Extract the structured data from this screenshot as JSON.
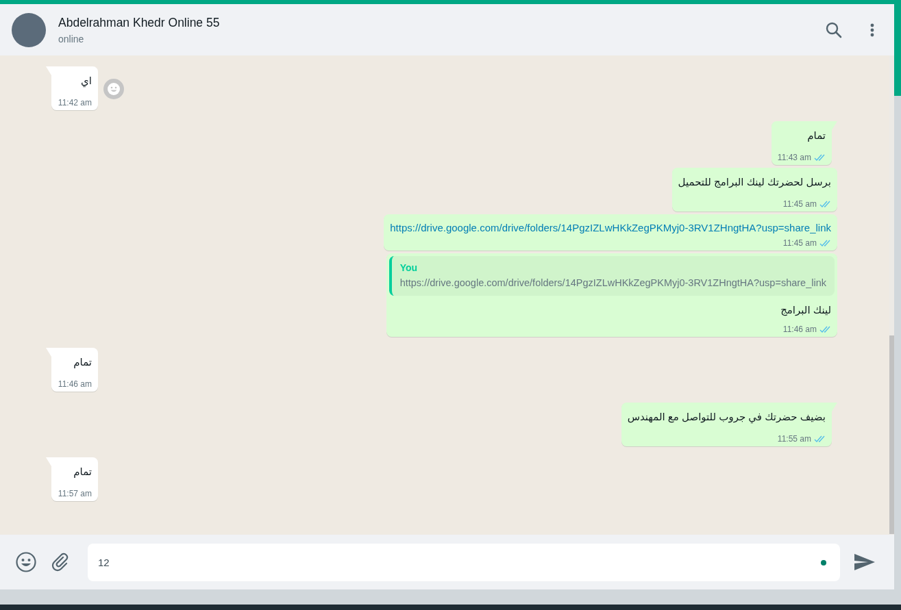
{
  "header": {
    "contact_name": "Abdelrahman Khedr Online 55",
    "status": "online"
  },
  "messages": [
    {
      "kind": "text",
      "outgoing": false,
      "tail": true,
      "hovered": true,
      "text": "اي",
      "time": "11:42 am"
    },
    {
      "kind": "text",
      "outgoing": true,
      "tail": true,
      "hovered": false,
      "text": "تمام",
      "time": "11:43 am",
      "read": true
    },
    {
      "kind": "text",
      "outgoing": true,
      "tail": false,
      "hovered": false,
      "text": "برسل لحضرتك لينك البرامج للتحميل",
      "time": "11:45 am",
      "read": true
    },
    {
      "kind": "link",
      "outgoing": true,
      "tail": false,
      "hovered": false,
      "text": "https://drive.google.com/drive/folders/14PgzIZLwHKkZegPKMyj0-3RV1ZHngtHA?usp=share_link",
      "time": "11:45 am",
      "read": true
    },
    {
      "kind": "reply",
      "outgoing": true,
      "tail": false,
      "hovered": false,
      "quote": {
        "author": "You",
        "text": "https://drive.google.com/drive/folders/14PgzIZLwHKkZegPKMyj0-3RV1ZHngtHA?usp=share_link"
      },
      "text": "لينك البرامج",
      "time": "11:46 am",
      "read": true
    },
    {
      "kind": "text",
      "outgoing": false,
      "tail": true,
      "hovered": false,
      "text": "تمام",
      "time": "11:46 am"
    },
    {
      "kind": "text",
      "outgoing": true,
      "tail": true,
      "hovered": false,
      "text": "بضيف حضرتك في جروب للتواصل مع المهندس",
      "time": "11:55 am",
      "read": true
    },
    {
      "kind": "text",
      "outgoing": false,
      "tail": true,
      "hovered": false,
      "text": "تمام",
      "time": "11:57 am"
    }
  ],
  "composer": {
    "value": "12"
  }
}
